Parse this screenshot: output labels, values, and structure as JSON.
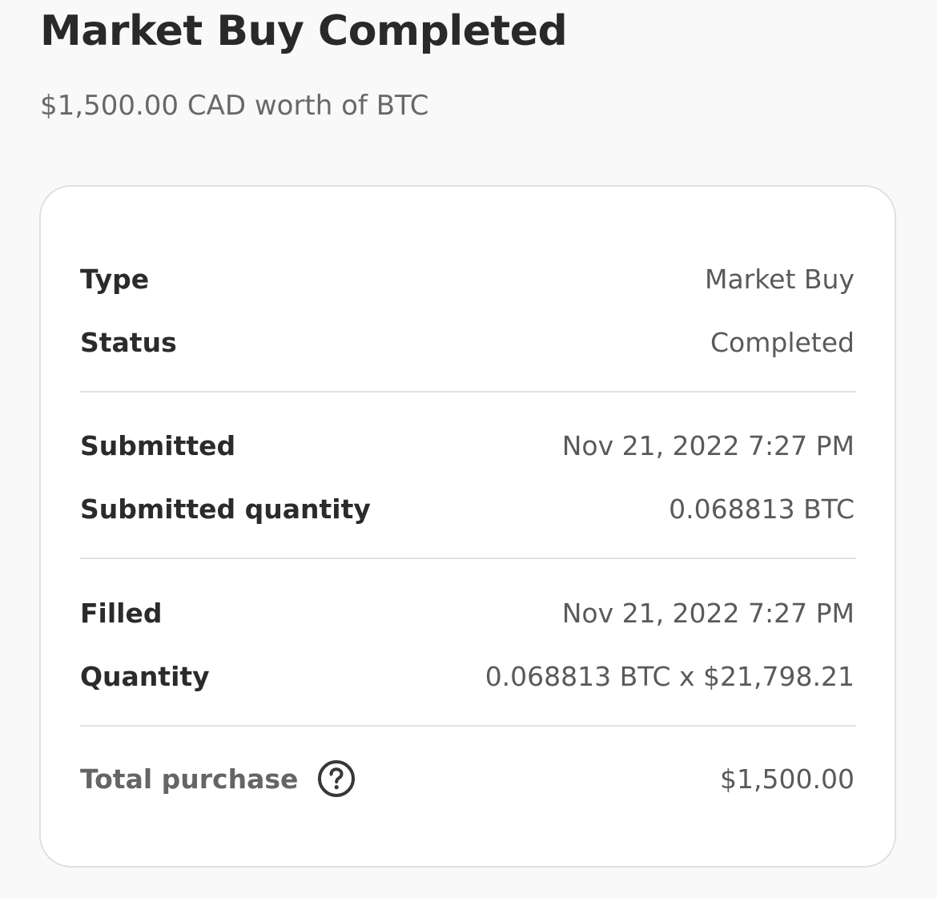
{
  "header": {
    "title": "Market Buy Completed",
    "subtitle": "$1,500.00 CAD worth of BTC"
  },
  "details": {
    "type": {
      "label": "Type",
      "value": "Market Buy"
    },
    "status": {
      "label": "Status",
      "value": "Completed"
    },
    "submitted": {
      "label": "Submitted",
      "value": "Nov 21, 2022 7:27 PM"
    },
    "submitted_quantity": {
      "label": "Submitted quantity",
      "value": "0.068813 BTC"
    },
    "filled": {
      "label": "Filled",
      "value": "Nov 21, 2022 7:27 PM"
    },
    "quantity": {
      "label": "Quantity",
      "value": "0.068813 BTC x $21,798.21"
    },
    "total_purchase": {
      "label": "Total purchase",
      "value": "$1,500.00",
      "help_icon": "question-circle-icon"
    }
  },
  "colors": {
    "background": "#f9f9f9",
    "card": "#ffffff",
    "card_border": "#e1e0e0",
    "text_primary": "#2c2a2a",
    "text_secondary": "#5c5959"
  }
}
